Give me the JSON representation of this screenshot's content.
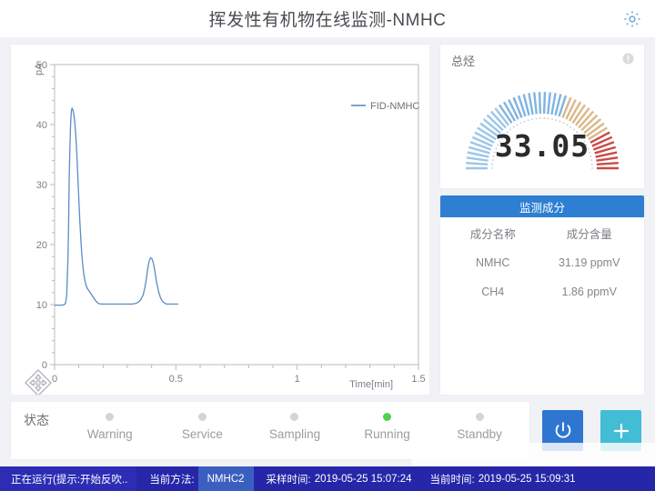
{
  "header": {
    "title": "挥发性有机物在线监测-NMHC",
    "gear_icon": "gear-icon"
  },
  "chart_panel": {
    "legend_label": "FID-NMHC",
    "move_icon": "move-pan-icon"
  },
  "chart_data": {
    "type": "line",
    "title": "",
    "xlabel": "Time[min]",
    "ylabel": "pA",
    "xlim": [
      0,
      1.5
    ],
    "ylim": [
      0,
      50
    ],
    "xticks": [
      0,
      0.5,
      1,
      1.5
    ],
    "xtick_labels": [
      "0",
      "0.5",
      "1",
      "1.5"
    ],
    "yticks": [
      0,
      10,
      20,
      30,
      40,
      50
    ],
    "ytick_labels": [
      "0",
      "10",
      "20",
      "30",
      "40",
      "50"
    ],
    "grid": false,
    "legend_position": "top-right",
    "series": [
      {
        "name": "FID-NMHC",
        "color": "#5b8cc4",
        "x": [
          0.0,
          0.01,
          0.02,
          0.03,
          0.04,
          0.045,
          0.05,
          0.055,
          0.058,
          0.06,
          0.063,
          0.066,
          0.069,
          0.072,
          0.075,
          0.078,
          0.081,
          0.084,
          0.087,
          0.09,
          0.093,
          0.096,
          0.1,
          0.104,
          0.108,
          0.112,
          0.116,
          0.12,
          0.125,
          0.13,
          0.135,
          0.14,
          0.145,
          0.15,
          0.16,
          0.17,
          0.18,
          0.19,
          0.2,
          0.22,
          0.24,
          0.26,
          0.28,
          0.3,
          0.32,
          0.335,
          0.345,
          0.355,
          0.365,
          0.372,
          0.378,
          0.384,
          0.39,
          0.396,
          0.402,
          0.408,
          0.414,
          0.42,
          0.428,
          0.436,
          0.444,
          0.452,
          0.46,
          0.47,
          0.48,
          0.49,
          0.5,
          0.51
        ],
        "y": [
          9.9,
          9.9,
          9.9,
          9.9,
          10.0,
          10.2,
          11.6,
          17.5,
          24.0,
          30.5,
          36.0,
          40.0,
          42.2,
          42.7,
          42.5,
          42.0,
          41.2,
          40.0,
          38.5,
          36.5,
          34.0,
          31.2,
          27.5,
          24.0,
          21.0,
          18.5,
          16.6,
          15.2,
          14.0,
          13.2,
          12.7,
          12.4,
          12.1,
          11.8,
          11.2,
          10.6,
          10.2,
          10.1,
          10.1,
          10.1,
          10.1,
          10.1,
          10.1,
          10.1,
          10.1,
          10.2,
          10.4,
          10.8,
          11.6,
          12.8,
          14.2,
          16.0,
          17.3,
          17.8,
          17.6,
          16.8,
          15.4,
          13.8,
          12.3,
          11.2,
          10.6,
          10.3,
          10.1,
          10.1,
          10.1,
          10.1,
          10.1,
          10.1
        ]
      }
    ],
    "peaks": [
      {
        "name": "CH4",
        "retention_time": 0.072,
        "height": 42.7
      },
      {
        "name": "NMHC",
        "retention_time": 0.396,
        "height": 17.8
      }
    ]
  },
  "gauge": {
    "label": "总烃",
    "value": "33.05",
    "info_icon": "info-circle-icon",
    "tick_colors": [
      "#9cc6e8",
      "#7fb4e0",
      "#d9b98a",
      "#c94b46"
    ]
  },
  "components_table": {
    "title": "监测成分",
    "columns": [
      "成分名称",
      "成分含量"
    ],
    "rows": [
      {
        "name": "NMHC",
        "value": "31.19 ppmV"
      },
      {
        "name": "CH4",
        "value": "1.86 ppmV"
      }
    ]
  },
  "status": {
    "title": "状态",
    "items": [
      {
        "label": "Warning",
        "active": false
      },
      {
        "label": "Service",
        "active": false
      },
      {
        "label": "Sampling",
        "active": false
      },
      {
        "label": "Running",
        "active": true
      },
      {
        "label": "Standby",
        "active": false
      }
    ],
    "active_color": "#4fd24f",
    "inactive_color": "#d3d4d9"
  },
  "actions": {
    "power_icon": "power-icon",
    "add_icon": "plus-icon",
    "power_color": "#2f76d0",
    "add_color": "#43bcd6"
  },
  "bottom_bar": {
    "running_text": "正在运行(提示:开始反吹..",
    "method_label": "当前方法:",
    "method_value": "NMHC2",
    "sample_time_label": "采样时间:",
    "sample_time_value": "2019-05-25 15:07:24",
    "current_time_label": "当前时间:",
    "current_time_value": "2019-05-25 15:09:31"
  }
}
